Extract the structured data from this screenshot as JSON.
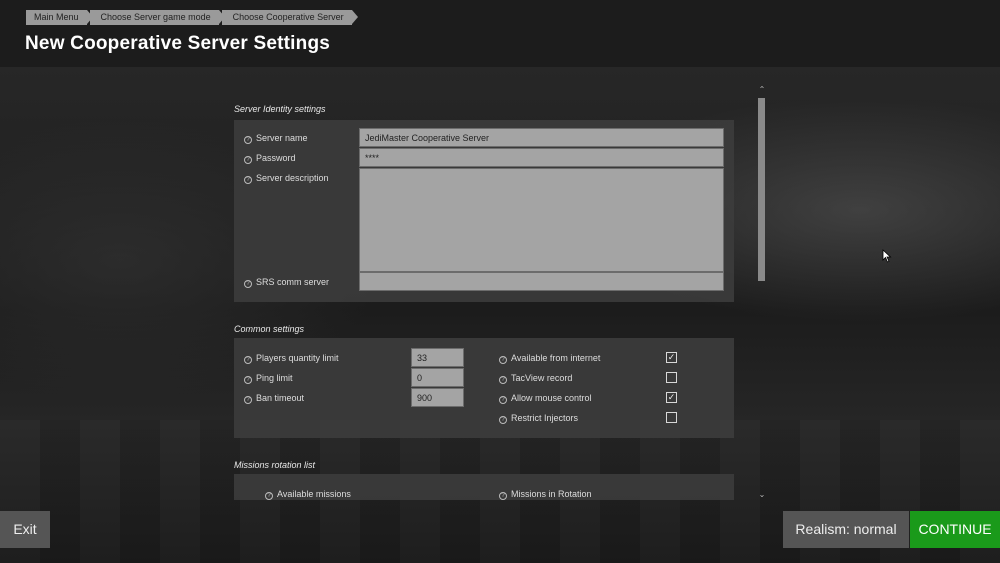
{
  "breadcrumb": [
    "Main Menu",
    "Choose Server game mode",
    "Choose Cooperative Server"
  ],
  "page_title": "New Cooperative Server Settings",
  "help_glyph": "?",
  "identity": {
    "title": "Server Identity settings",
    "server_name_label": "Server name",
    "server_name_value": "JediMaster Cooperative Server",
    "password_label": "Password",
    "password_value": "****",
    "description_label": "Server description",
    "description_value": "",
    "srs_label": "SRS comm server",
    "srs_value": ""
  },
  "common": {
    "title": "Common settings",
    "players_label": "Players quantity limit",
    "players_value": "33",
    "ping_label": "Ping limit",
    "ping_value": "0",
    "ban_label": "Ban timeout",
    "ban_value": "900",
    "internet_label": "Available from internet",
    "internet_checked": true,
    "tacview_label": "TacView record",
    "tacview_checked": false,
    "mouse_label": "Allow mouse control",
    "mouse_checked": true,
    "injectors_label": "Restrict Injectors",
    "injectors_checked": false
  },
  "missions": {
    "title": "Missions rotation list",
    "available_label": "Available missions",
    "rotation_label": "Missions in Rotation"
  },
  "footer": {
    "exit_label": "Exit",
    "realism_label": "Realism: normal",
    "continue_label": "CONTINUE"
  },
  "colors": {
    "accent_green": "#1a9a1a",
    "field_bg": "#a4a4a4",
    "panel_bg": "#3c3c3c"
  }
}
